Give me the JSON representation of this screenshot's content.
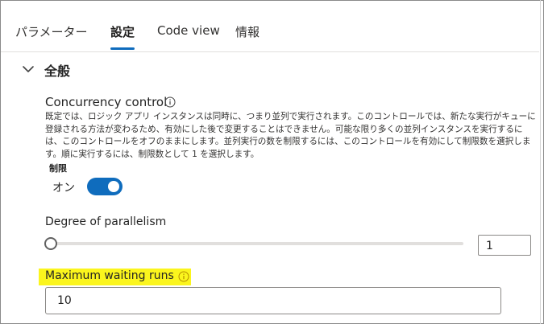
{
  "tabs": [
    {
      "label": "パラメーター"
    },
    {
      "label": "設定",
      "active": true
    },
    {
      "label": "Code view"
    },
    {
      "label": "情報"
    }
  ],
  "section": {
    "title": "全般",
    "expanded": true
  },
  "concurrency": {
    "title": "Concurrency control",
    "description": "既定では、ロジック アプリ インスタンスは同時に、つまり並列で実行されます。このコントロールでは、新たな実行がキューに登録される方法が変わるため、有効にした後で変更することはできません。可能な限り多くの並列インスタンスを実行するには、このコントロールをオフのままにします。並列実行の数を制限するには、このコントロールを有効にして制限数を選択します。順に実行するには、制限数として 1 を選択します。",
    "limit_label": "制限",
    "toggle_text": "オン",
    "toggle_on": true
  },
  "parallelism": {
    "label": "Degree of parallelism",
    "value": "1",
    "slider_fraction": 0
  },
  "waiting_runs": {
    "label": "Maximum waiting runs",
    "value": "10"
  },
  "colors": {
    "accent": "#0f6cbd",
    "highlight": "#fbf51d",
    "info_icon_highlight": "#b58e00"
  }
}
